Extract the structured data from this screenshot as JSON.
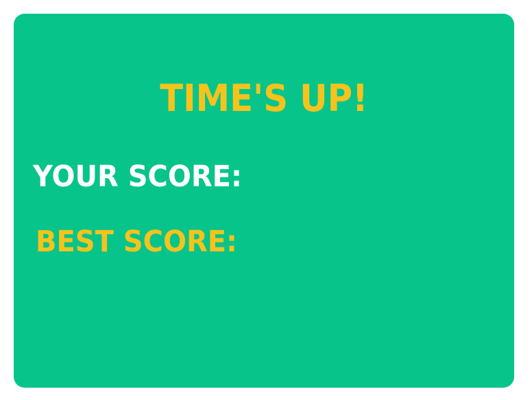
{
  "dialog": {
    "title": "TIME'S UP!",
    "your_score_label": "YOUR SCORE:",
    "best_score_label": "BEST SCORE:"
  },
  "colors": {
    "panel_background": "#07c48a",
    "title_color": "#f6c31c",
    "your_score_color": "#ffffff",
    "best_score_color": "#f6c31c"
  }
}
